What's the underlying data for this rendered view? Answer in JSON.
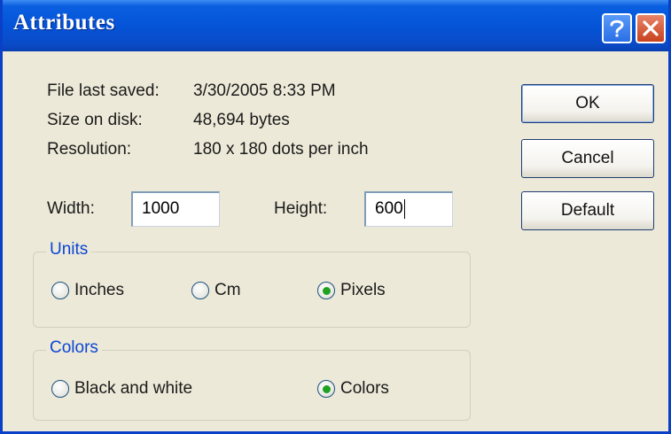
{
  "window": {
    "title": "Attributes"
  },
  "titlebar": {
    "help_icon": "help-question-icon",
    "close_icon": "close-x-icon"
  },
  "info": {
    "file_last_saved_label": "File last saved:",
    "file_last_saved_value": "3/30/2005 8:33 PM",
    "size_on_disk_label": "Size on disk:",
    "size_on_disk_value": "48,694 bytes",
    "resolution_label": "Resolution:",
    "resolution_value": "180 x 180 dots per inch"
  },
  "dimensions": {
    "width_label": "Width:",
    "width_value": "1000",
    "height_label": "Height:",
    "height_value": "600"
  },
  "units": {
    "title": "Units",
    "options": [
      {
        "label": "Inches",
        "selected": false
      },
      {
        "label": "Cm",
        "selected": false
      },
      {
        "label": "Pixels",
        "selected": true
      }
    ]
  },
  "colors": {
    "title": "Colors",
    "options": [
      {
        "label": "Black and white",
        "selected": false
      },
      {
        "label": "Colors",
        "selected": true
      }
    ]
  },
  "buttons": {
    "ok": "OK",
    "cancel": "Cancel",
    "default": "Default"
  },
  "theme": {
    "titlebar_blue": "#0554d8",
    "group_title_color": "#0b46d5",
    "radio_selected_color": "#21a121"
  }
}
